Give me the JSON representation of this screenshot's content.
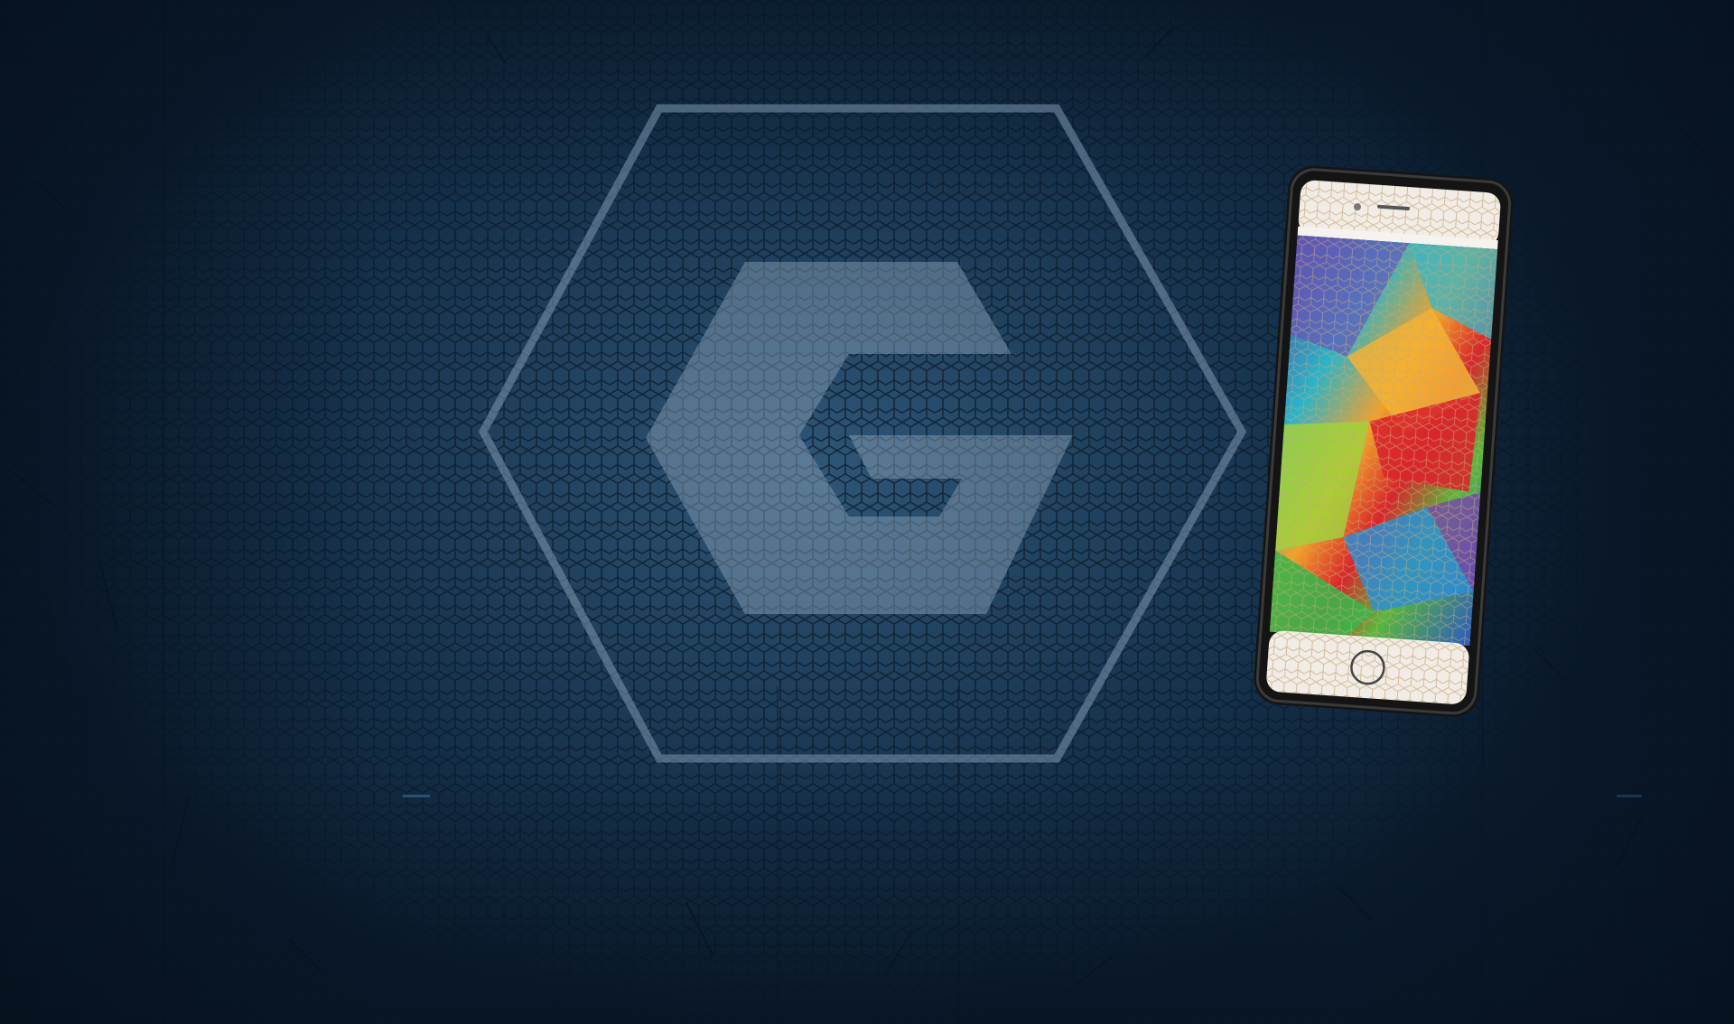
{
  "scene": {
    "background_color": "#1c3b58",
    "logo": {
      "icon": "g-hexagon-logo-icon",
      "color": "#8fa7bd"
    },
    "phone": {
      "icon": "smartphone-icon",
      "frame_color": "#151515"
    }
  }
}
